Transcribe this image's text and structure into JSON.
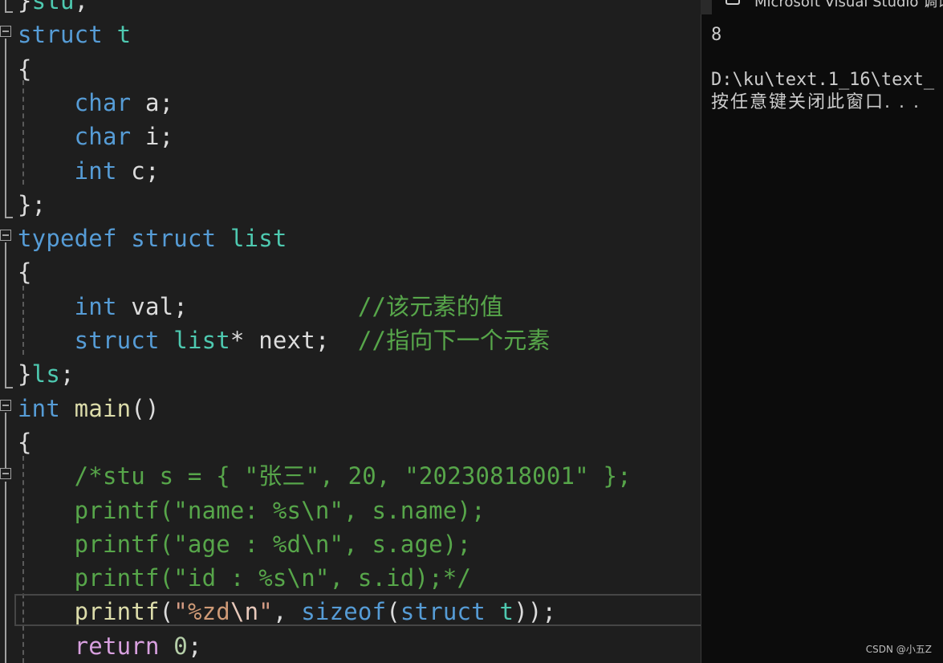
{
  "editor": {
    "code_lines": [
      [
        {
          "t": "}",
          "c": "id"
        },
        {
          "t": "stu",
          "c": "ty"
        },
        {
          "t": ";",
          "c": "id"
        }
      ],
      [
        {
          "t": "struct",
          "c": "kw"
        },
        {
          "t": " ",
          "c": "id"
        },
        {
          "t": "t",
          "c": "ty"
        }
      ],
      [
        {
          "t": "{",
          "c": "id"
        }
      ],
      [
        {
          "t": "    ",
          "c": "id"
        },
        {
          "t": "char",
          "c": "kw"
        },
        {
          "t": " a;",
          "c": "id"
        }
      ],
      [
        {
          "t": "    ",
          "c": "id"
        },
        {
          "t": "char",
          "c": "kw"
        },
        {
          "t": " i;",
          "c": "id"
        }
      ],
      [
        {
          "t": "    ",
          "c": "id"
        },
        {
          "t": "int",
          "c": "kw"
        },
        {
          "t": " c;",
          "c": "id"
        }
      ],
      [
        {
          "t": "};",
          "c": "id"
        }
      ],
      [
        {
          "t": "typedef",
          "c": "kw"
        },
        {
          "t": " ",
          "c": "id"
        },
        {
          "t": "struct",
          "c": "kw"
        },
        {
          "t": " ",
          "c": "id"
        },
        {
          "t": "list",
          "c": "ty"
        }
      ],
      [
        {
          "t": "{",
          "c": "id"
        }
      ],
      [
        {
          "t": "    ",
          "c": "id"
        },
        {
          "t": "int",
          "c": "kw"
        },
        {
          "t": " val;",
          "c": "id"
        },
        {
          "t": "            ",
          "c": "id"
        },
        {
          "t": "//该元素的值",
          "c": "cm"
        }
      ],
      [
        {
          "t": "    ",
          "c": "id"
        },
        {
          "t": "struct",
          "c": "kw"
        },
        {
          "t": " ",
          "c": "id"
        },
        {
          "t": "list",
          "c": "ty"
        },
        {
          "t": "* next;",
          "c": "id"
        },
        {
          "t": "  ",
          "c": "id"
        },
        {
          "t": "//指向下一个元素",
          "c": "cm"
        }
      ],
      [
        {
          "t": "}",
          "c": "id"
        },
        {
          "t": "ls",
          "c": "ty"
        },
        {
          "t": ";",
          "c": "id"
        }
      ],
      [
        {
          "t": "int",
          "c": "kw"
        },
        {
          "t": " ",
          "c": "id"
        },
        {
          "t": "main",
          "c": "fn"
        },
        {
          "t": "()",
          "c": "id"
        }
      ],
      [
        {
          "t": "{",
          "c": "id"
        }
      ],
      [
        {
          "t": "    ",
          "c": "id"
        },
        {
          "t": "/*stu s = { \"张三\", 20, \"20230818001\" };",
          "c": "cm"
        }
      ],
      [
        {
          "t": "    ",
          "c": "id"
        },
        {
          "t": "printf(\"name: %s\\n\", s.name);",
          "c": "cm"
        }
      ],
      [
        {
          "t": "    ",
          "c": "id"
        },
        {
          "t": "printf(\"age : %d\\n\", s.age);",
          "c": "cm"
        }
      ],
      [
        {
          "t": "    ",
          "c": "id"
        },
        {
          "t": "printf(\"id : %s\\n\", s.id);*/",
          "c": "cm"
        }
      ],
      [
        {
          "t": "    ",
          "c": "id"
        },
        {
          "t": "printf",
          "c": "fn"
        },
        {
          "t": "(",
          "c": "id"
        },
        {
          "t": "\"",
          "c": "str"
        },
        {
          "t": "%zd",
          "c": "fmt"
        },
        {
          "t": "\\n",
          "c": "esc"
        },
        {
          "t": "\"",
          "c": "str"
        },
        {
          "t": ", ",
          "c": "id"
        },
        {
          "t": "sizeof",
          "c": "kw"
        },
        {
          "t": "(",
          "c": "id"
        },
        {
          "t": "struct",
          "c": "kw"
        },
        {
          "t": " ",
          "c": "id"
        },
        {
          "t": "t",
          "c": "ty"
        },
        {
          "t": "));",
          "c": "id"
        }
      ],
      [
        {
          "t": "    ",
          "c": "id"
        },
        {
          "t": "return",
          "c": "kwr"
        },
        {
          "t": " ",
          "c": "id"
        },
        {
          "t": "0",
          "c": "num"
        },
        {
          "t": ";",
          "c": "id"
        }
      ]
    ]
  },
  "console": {
    "tab_title": "Microsoft Visual Studio 调试",
    "lines": [
      "8",
      "",
      "D:\\ku\\text.1_16\\text_",
      "按任意键关闭此窗口. . ."
    ]
  },
  "watermark": "CSDN @小五Z",
  "colors": {
    "editor_bg": "#1e1e1e",
    "console_bg": "#0c0c0c",
    "keyword": "#569cd6",
    "type": "#4ec9b0",
    "function": "#dcdcaa",
    "comment": "#57a64a",
    "string": "#d69d85",
    "control_keyword": "#d8a0df",
    "number": "#b5cea8"
  }
}
